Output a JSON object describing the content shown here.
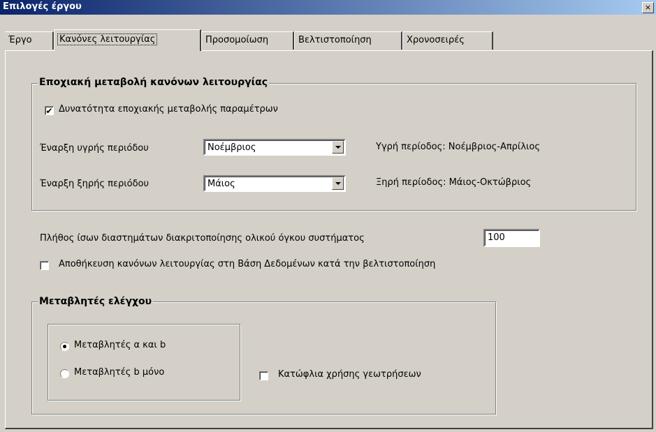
{
  "window": {
    "title": "Επιλογές έργου",
    "close_glyph": "×"
  },
  "tabs": [
    {
      "label": "Έργο"
    },
    {
      "label": "Κανόνες λειτουργίας"
    },
    {
      "label": "Προσομοίωση"
    },
    {
      "label": "Βελτιστοποίηση"
    },
    {
      "label": "Χρονοσειρές"
    }
  ],
  "seasonal": {
    "group_title": "Εποχιακή μεταβολή κανόνων λειτουργίας",
    "enable_label": "Δυνατότητα εποχιακής μεταβολής παραμέτρων",
    "enable_checked": true,
    "wet_label": "Έναρξη υγρής περιόδου",
    "wet_value": "Νοέμβριος",
    "wet_info": "Υγρή περίοδος: Νοέμβριος-Απρίλιος",
    "dry_label": "Έναρξη ξηρής περιόδου",
    "dry_value": "Μάιος",
    "dry_info": "Ξηρή περίοδος: Μάιος-Οκτώβριος"
  },
  "discretization": {
    "label": "Πλήθος ίσων διαστημάτων διακριτοποίησης ολικού όγκου συστήματος",
    "value": "100"
  },
  "save_rules": {
    "label": "Αποθήκευση κανόνων λειτουργίας στη Βάση Δεδομένων κατά την βελτιστοποίηση",
    "checked": false
  },
  "control_vars": {
    "group_title": "Μεταβλητές ελέγχου",
    "option_ab": "Μεταβλητές α και b",
    "option_b": "Μεταβλητές b μόνο",
    "selected": "ab",
    "thresholds_label": "Κατώφλια χρήσης γεωτρήσεων",
    "thresholds_checked": false
  },
  "glyphs": {
    "check": "✔"
  }
}
